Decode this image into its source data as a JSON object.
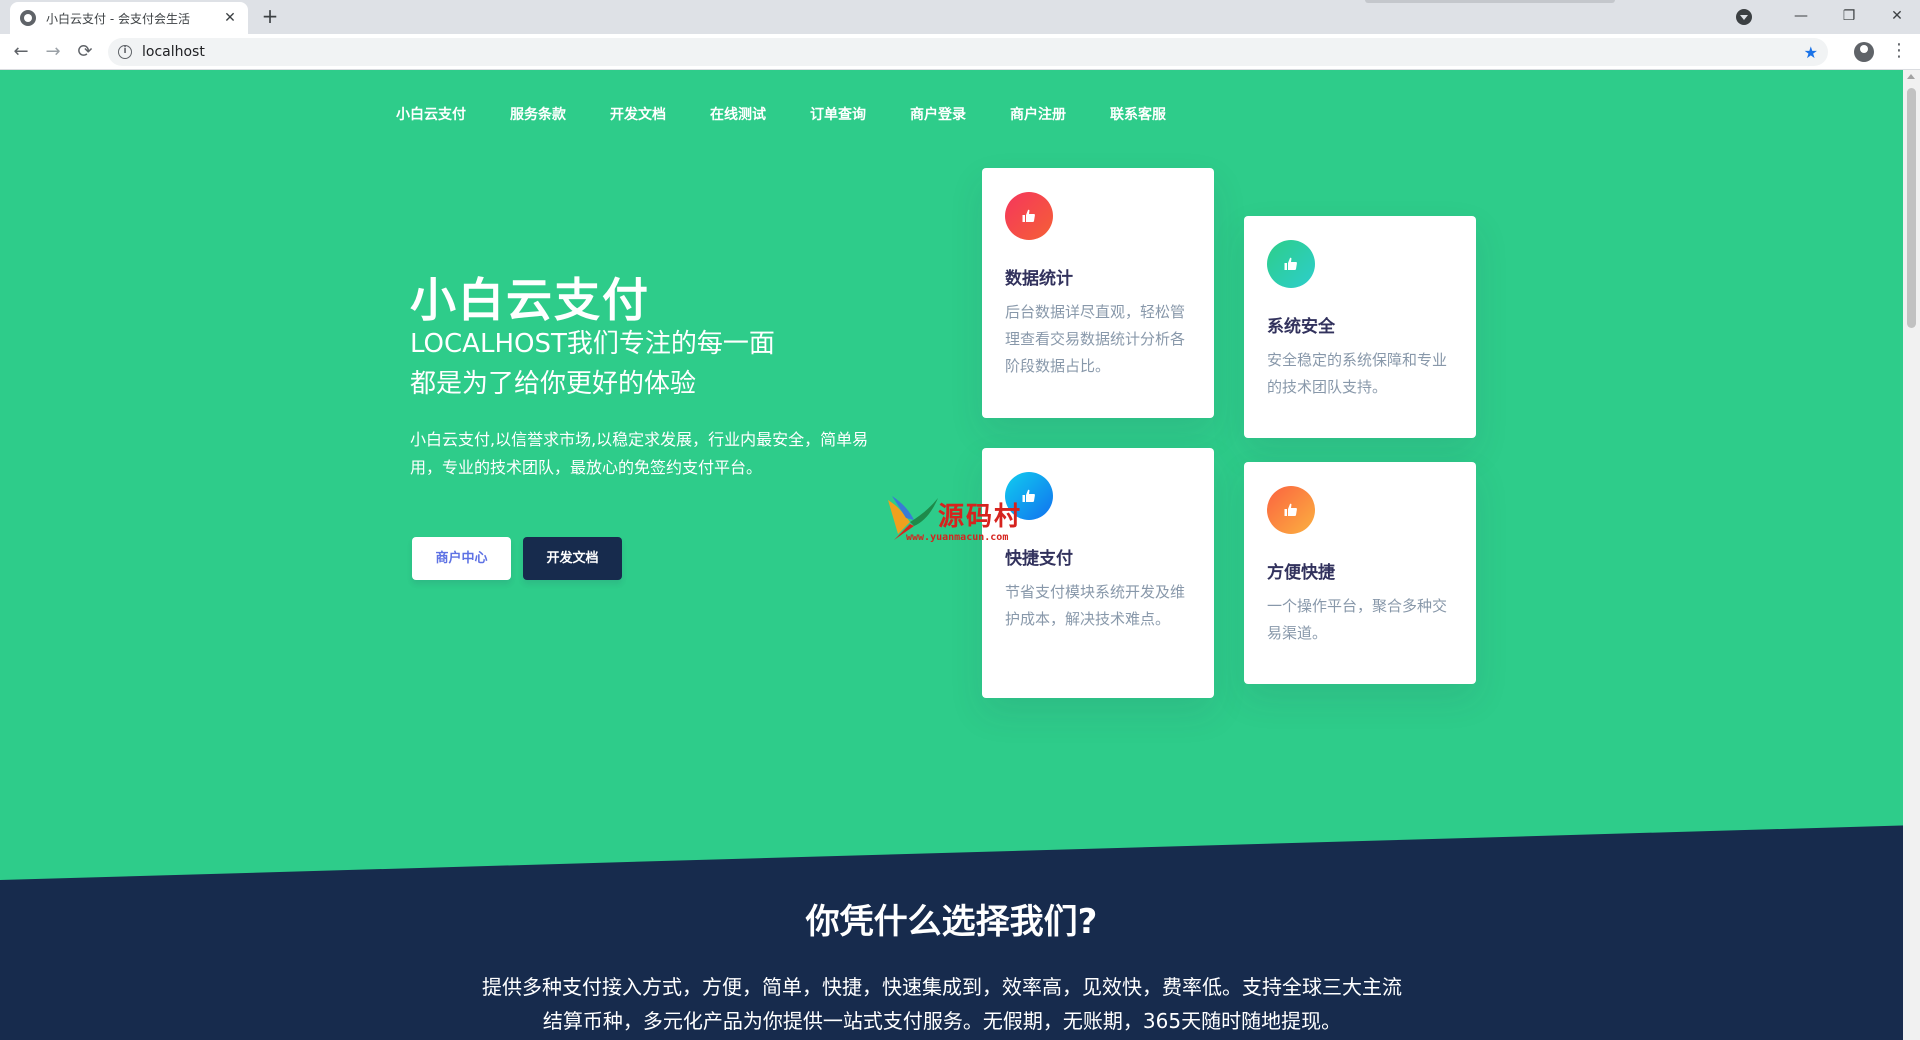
{
  "browser": {
    "tab_title": "小白云支付 - 会支付会生活",
    "tab_close": "✕",
    "new_tab": "+",
    "url": "localhost",
    "back": "←",
    "forward": "→",
    "reload": "⟳",
    "star": "★",
    "minimize": "—",
    "restore": "❐",
    "close": "✕",
    "menu": "⋮"
  },
  "nav": {
    "items": [
      "小白云支付",
      "服务条款",
      "开发文档",
      "在线测试",
      "订单查询",
      "商户登录",
      "商户注册",
      "联系客服"
    ]
  },
  "hero": {
    "title": "小白云支付",
    "subtitle_line1": "LOCALHOST我们专注的每一面",
    "subtitle_line2": "都是为了给你更好的体验",
    "description": "小白云支付,以信誉求市场,以稳定求发展，行业内最安全，简单易用，专业的技术团队，最放心的免签约支付平台。",
    "btn_merchant": "商户中心",
    "btn_docs": "开发文档"
  },
  "cards": [
    {
      "title": "数据统计",
      "text": "后台数据详尽直观，轻松管理查看交易数据统计分析各阶段数据占比。",
      "color": "#f5365c",
      "icon": "thumb-icon"
    },
    {
      "title": "系统安全",
      "text": "安全稳定的系统保障和专业的技术团队支持。",
      "color": "#2dce89",
      "icon": "thumb-icon"
    },
    {
      "title": "快捷支付",
      "text": "节省支付模块系统开发及维护成本，解决技术难点。",
      "color": "#11cdef",
      "icon": "thumb-icon"
    },
    {
      "title": "方便快捷",
      "text": "一个操作平台，聚合多种交易渠道。",
      "color": "#fb6340",
      "icon": "thumb-icon"
    }
  ],
  "watermark": {
    "text": "源码村",
    "url": "www.yuanmacun.com"
  },
  "why": {
    "title": "你凭什么选择我们?",
    "desc_line1": "提供多种支付接入方式，方便，简单，快捷，快速集成到，效率高，见效快，费率低。支持全球三大主流",
    "desc_line2": "结算币种，多元化产品为你提供一站式支付服务。无假期，无账期，365天随时随地提现。"
  },
  "colors": {
    "green": "#2ecc8a",
    "navy": "#172b4d"
  }
}
